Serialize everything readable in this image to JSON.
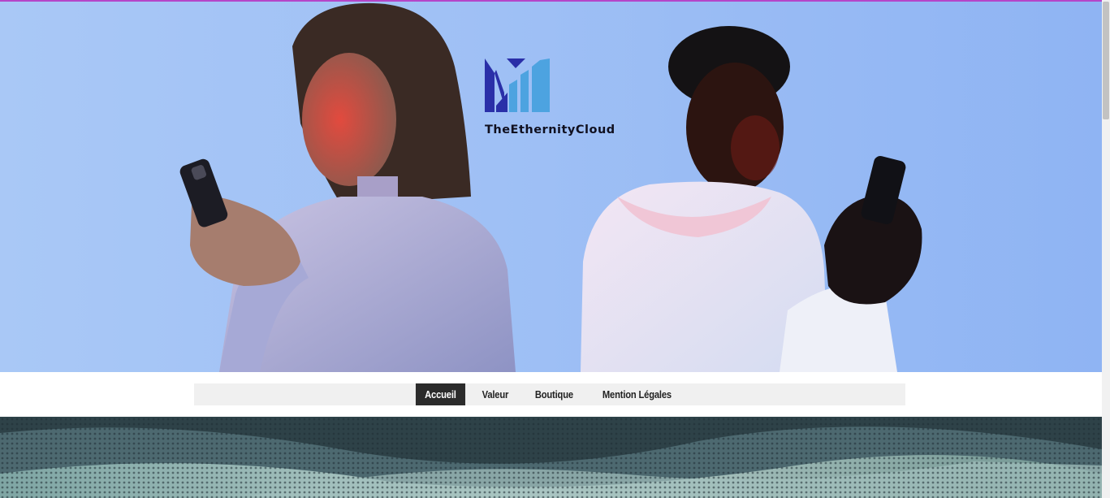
{
  "brand": {
    "name": "TheEthernityCloud",
    "colors": {
      "dark_blue": "#2a2fa8",
      "light_blue": "#4da3e0",
      "accent_top": "#b545c8"
    }
  },
  "hero": {
    "image": "hero-photo-two-people-with-phones"
  },
  "nav": {
    "items": [
      {
        "label": "Accueil",
        "active": true
      },
      {
        "label": "Valeur",
        "active": false
      },
      {
        "label": "Boutique",
        "active": false
      },
      {
        "label": "Mention Légales",
        "active": false
      }
    ]
  },
  "banner": {
    "image": "teal-digital-wave-texture"
  }
}
